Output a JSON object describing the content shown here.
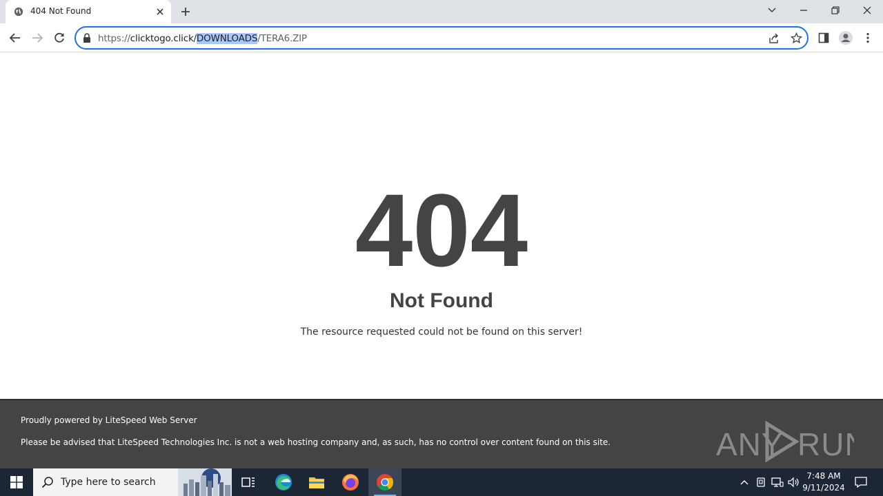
{
  "browser": {
    "tab_title": "404 Not Found",
    "url_scheme": "https://",
    "url_host": "clicktogo.click/",
    "url_selected": "DOWNLOADS",
    "url_rest": "/TERA6.ZIP"
  },
  "page": {
    "code": "404",
    "heading": "Not Found",
    "message": "The resource requested could not be found on this server!",
    "footer_line1": "Proudly powered by LiteSpeed Web Server",
    "footer_line2": "Please be advised that LiteSpeed Technologies Inc. is not a web hosting company and, as such, has no control over content found on this site."
  },
  "watermark": {
    "text": "ANY RUN"
  },
  "taskbar": {
    "search_placeholder": "Type here to search",
    "time": "7:48 AM",
    "date": "9/11/2024"
  },
  "colors": {
    "accent": "#1a73e8",
    "page_text": "#444444",
    "footer_bg": "#444444",
    "taskbar_bg": "#1c2634"
  }
}
